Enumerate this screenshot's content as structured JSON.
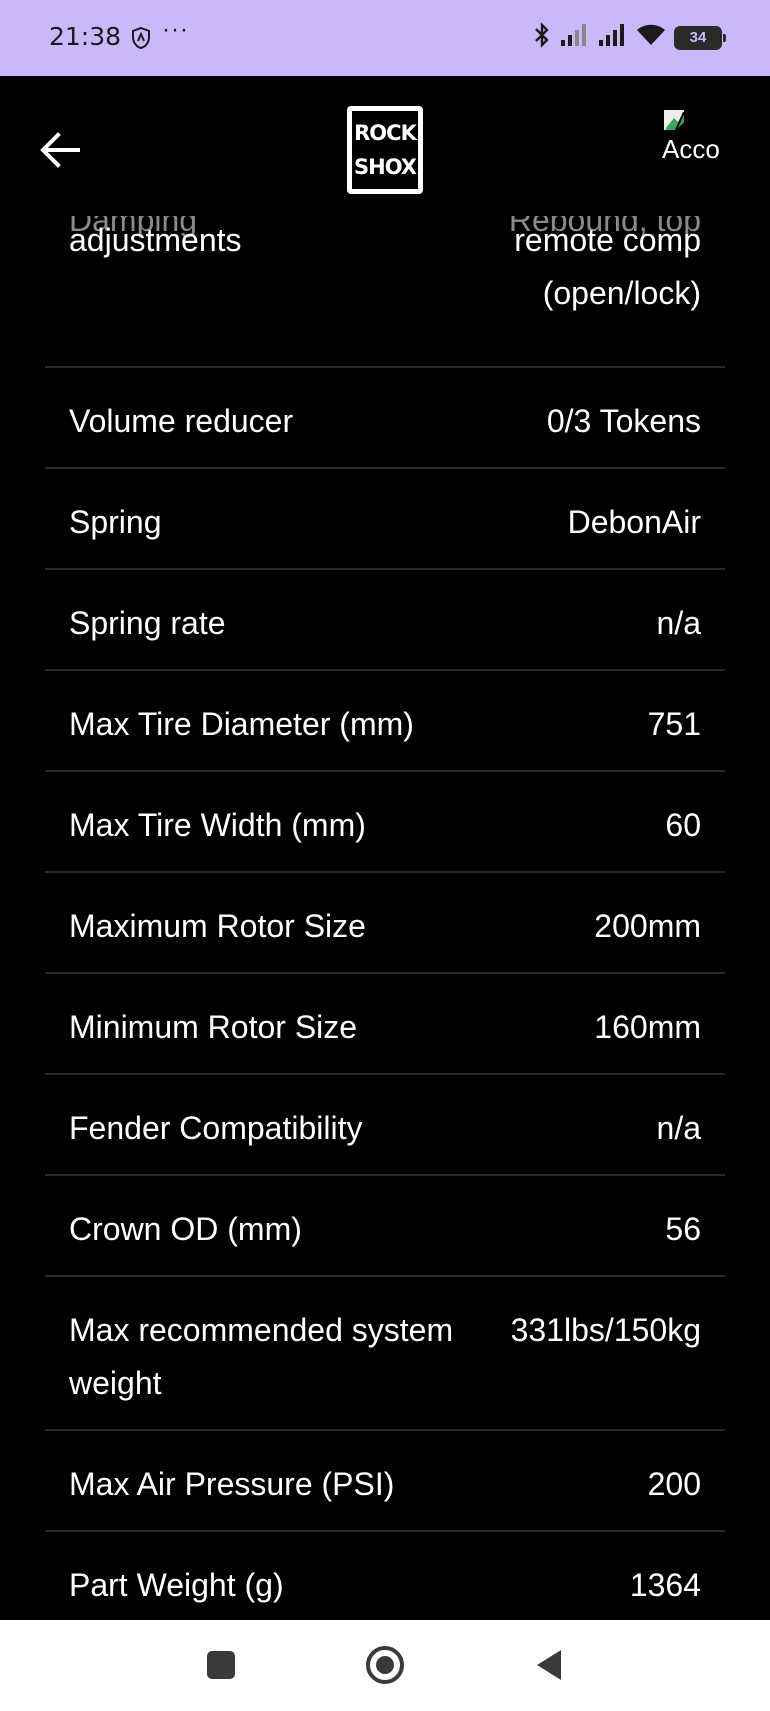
{
  "status_bar": {
    "time": "21:38",
    "dots": "···",
    "battery": "34"
  },
  "app_bar": {
    "logo_line1": "ROCK",
    "logo_line2": "SHOX",
    "account_label": "Acco"
  },
  "specs": {
    "first_row": {
      "label_hidden": "Damping",
      "label": "adjustments",
      "value_hidden": "Rebound, top",
      "value_line1": "remote comp",
      "value_line2": "(open/lock)"
    },
    "rows": [
      {
        "label": "Volume reducer",
        "value": "0/3 Tokens"
      },
      {
        "label": "Spring",
        "value": "DebonAir"
      },
      {
        "label": "Spring rate",
        "value": "n/a"
      },
      {
        "label": "Max Tire Diameter (mm)",
        "value": "751"
      },
      {
        "label": "Max Tire Width (mm)",
        "value": "60"
      },
      {
        "label": "Maximum Rotor Size",
        "value": "200mm"
      },
      {
        "label": "Minimum Rotor Size",
        "value": "160mm"
      },
      {
        "label": "Fender Compatibility",
        "value": "n/a"
      },
      {
        "label": "Crown OD (mm)",
        "value": "56"
      },
      {
        "label": "Max recommended system weight",
        "value": "331lbs/150kg"
      },
      {
        "label": "Max Air Pressure (PSI)",
        "value": "200"
      },
      {
        "label": "Part Weight (g)",
        "value": "1364"
      }
    ]
  },
  "colors": {
    "status_bar_bg": "#c9b8fa",
    "page_bg": "#000000",
    "divider": "#2a2a2a",
    "nav_bar_bg": "#ffffff"
  }
}
